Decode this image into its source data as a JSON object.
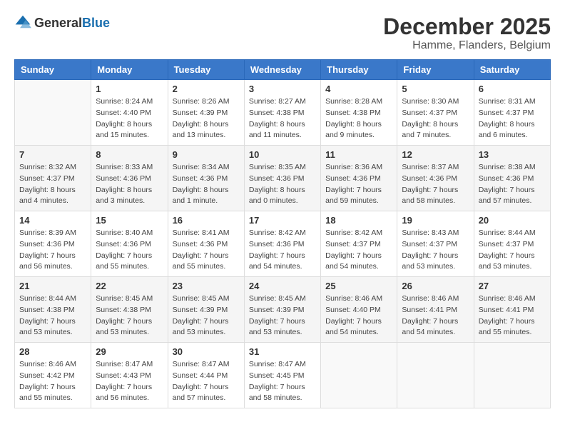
{
  "header": {
    "logo_general": "General",
    "logo_blue": "Blue",
    "title": "December 2025",
    "subtitle": "Hamme, Flanders, Belgium"
  },
  "days_of_week": [
    "Sunday",
    "Monday",
    "Tuesday",
    "Wednesday",
    "Thursday",
    "Friday",
    "Saturday"
  ],
  "weeks": [
    [
      {
        "day": "",
        "info": ""
      },
      {
        "day": "1",
        "info": "Sunrise: 8:24 AM\nSunset: 4:40 PM\nDaylight: 8 hours\nand 15 minutes."
      },
      {
        "day": "2",
        "info": "Sunrise: 8:26 AM\nSunset: 4:39 PM\nDaylight: 8 hours\nand 13 minutes."
      },
      {
        "day": "3",
        "info": "Sunrise: 8:27 AM\nSunset: 4:38 PM\nDaylight: 8 hours\nand 11 minutes."
      },
      {
        "day": "4",
        "info": "Sunrise: 8:28 AM\nSunset: 4:38 PM\nDaylight: 8 hours\nand 9 minutes."
      },
      {
        "day": "5",
        "info": "Sunrise: 8:30 AM\nSunset: 4:37 PM\nDaylight: 8 hours\nand 7 minutes."
      },
      {
        "day": "6",
        "info": "Sunrise: 8:31 AM\nSunset: 4:37 PM\nDaylight: 8 hours\nand 6 minutes."
      }
    ],
    [
      {
        "day": "7",
        "info": "Sunrise: 8:32 AM\nSunset: 4:37 PM\nDaylight: 8 hours\nand 4 minutes."
      },
      {
        "day": "8",
        "info": "Sunrise: 8:33 AM\nSunset: 4:36 PM\nDaylight: 8 hours\nand 3 minutes."
      },
      {
        "day": "9",
        "info": "Sunrise: 8:34 AM\nSunset: 4:36 PM\nDaylight: 8 hours\nand 1 minute."
      },
      {
        "day": "10",
        "info": "Sunrise: 8:35 AM\nSunset: 4:36 PM\nDaylight: 8 hours\nand 0 minutes."
      },
      {
        "day": "11",
        "info": "Sunrise: 8:36 AM\nSunset: 4:36 PM\nDaylight: 7 hours\nand 59 minutes."
      },
      {
        "day": "12",
        "info": "Sunrise: 8:37 AM\nSunset: 4:36 PM\nDaylight: 7 hours\nand 58 minutes."
      },
      {
        "day": "13",
        "info": "Sunrise: 8:38 AM\nSunset: 4:36 PM\nDaylight: 7 hours\nand 57 minutes."
      }
    ],
    [
      {
        "day": "14",
        "info": "Sunrise: 8:39 AM\nSunset: 4:36 PM\nDaylight: 7 hours\nand 56 minutes."
      },
      {
        "day": "15",
        "info": "Sunrise: 8:40 AM\nSunset: 4:36 PM\nDaylight: 7 hours\nand 55 minutes."
      },
      {
        "day": "16",
        "info": "Sunrise: 8:41 AM\nSunset: 4:36 PM\nDaylight: 7 hours\nand 55 minutes."
      },
      {
        "day": "17",
        "info": "Sunrise: 8:42 AM\nSunset: 4:36 PM\nDaylight: 7 hours\nand 54 minutes."
      },
      {
        "day": "18",
        "info": "Sunrise: 8:42 AM\nSunset: 4:37 PM\nDaylight: 7 hours\nand 54 minutes."
      },
      {
        "day": "19",
        "info": "Sunrise: 8:43 AM\nSunset: 4:37 PM\nDaylight: 7 hours\nand 53 minutes."
      },
      {
        "day": "20",
        "info": "Sunrise: 8:44 AM\nSunset: 4:37 PM\nDaylight: 7 hours\nand 53 minutes."
      }
    ],
    [
      {
        "day": "21",
        "info": "Sunrise: 8:44 AM\nSunset: 4:38 PM\nDaylight: 7 hours\nand 53 minutes."
      },
      {
        "day": "22",
        "info": "Sunrise: 8:45 AM\nSunset: 4:38 PM\nDaylight: 7 hours\nand 53 minutes."
      },
      {
        "day": "23",
        "info": "Sunrise: 8:45 AM\nSunset: 4:39 PM\nDaylight: 7 hours\nand 53 minutes."
      },
      {
        "day": "24",
        "info": "Sunrise: 8:45 AM\nSunset: 4:39 PM\nDaylight: 7 hours\nand 53 minutes."
      },
      {
        "day": "25",
        "info": "Sunrise: 8:46 AM\nSunset: 4:40 PM\nDaylight: 7 hours\nand 54 minutes."
      },
      {
        "day": "26",
        "info": "Sunrise: 8:46 AM\nSunset: 4:41 PM\nDaylight: 7 hours\nand 54 minutes."
      },
      {
        "day": "27",
        "info": "Sunrise: 8:46 AM\nSunset: 4:41 PM\nDaylight: 7 hours\nand 55 minutes."
      }
    ],
    [
      {
        "day": "28",
        "info": "Sunrise: 8:46 AM\nSunset: 4:42 PM\nDaylight: 7 hours\nand 55 minutes."
      },
      {
        "day": "29",
        "info": "Sunrise: 8:47 AM\nSunset: 4:43 PM\nDaylight: 7 hours\nand 56 minutes."
      },
      {
        "day": "30",
        "info": "Sunrise: 8:47 AM\nSunset: 4:44 PM\nDaylight: 7 hours\nand 57 minutes."
      },
      {
        "day": "31",
        "info": "Sunrise: 8:47 AM\nSunset: 4:45 PM\nDaylight: 7 hours\nand 58 minutes."
      },
      {
        "day": "",
        "info": ""
      },
      {
        "day": "",
        "info": ""
      },
      {
        "day": "",
        "info": ""
      }
    ]
  ]
}
